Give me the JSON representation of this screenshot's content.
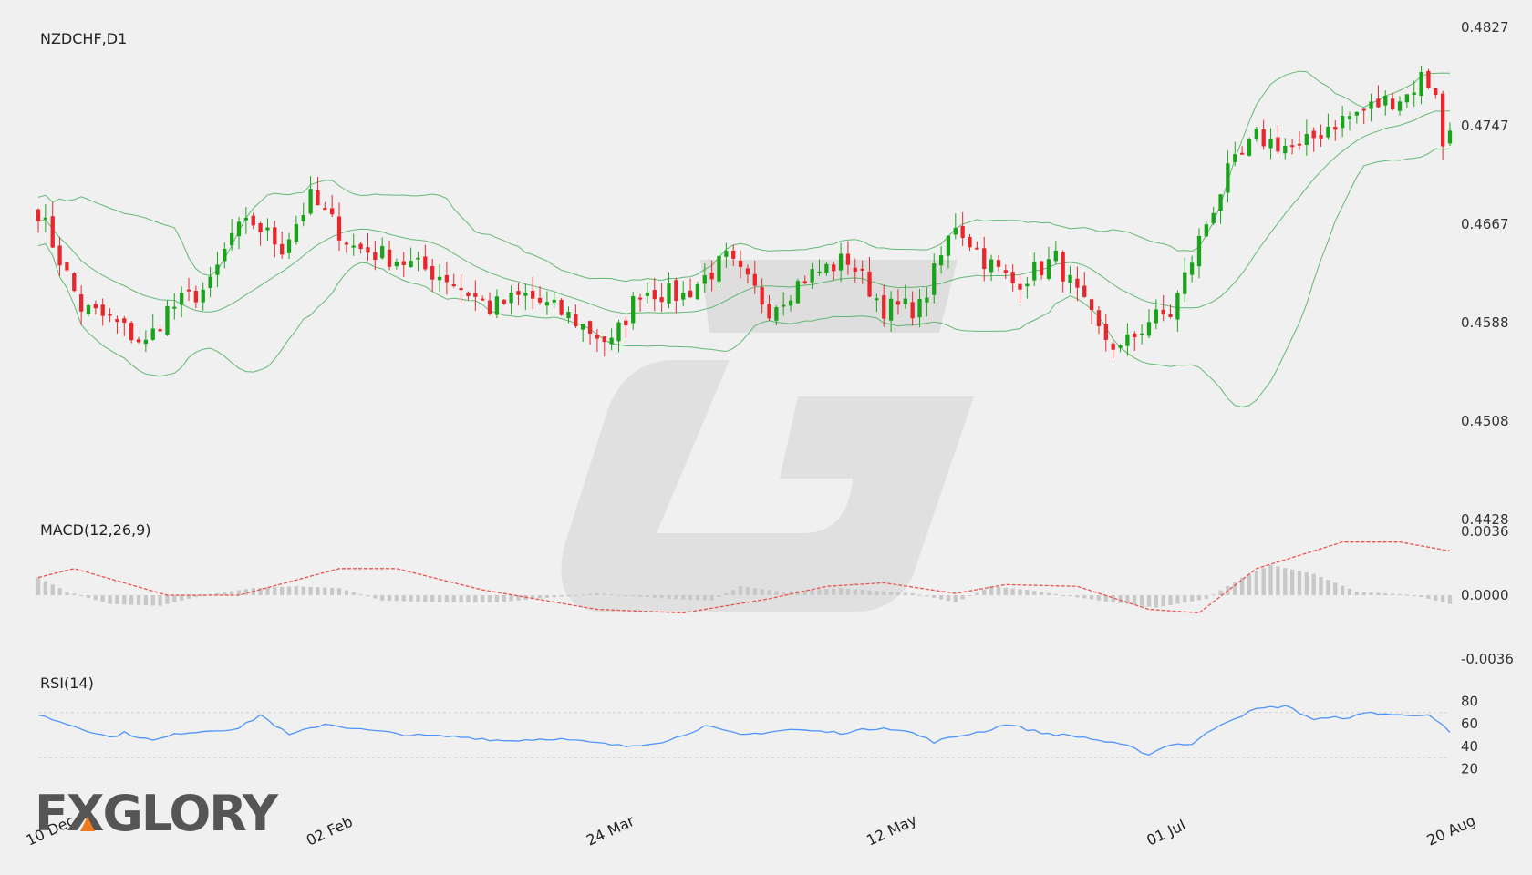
{
  "chart_data": {
    "type": "candlestick",
    "symbol_label": "NZDCHF,D1",
    "price_axis": {
      "ylim": [
        0.4428,
        0.4827
      ],
      "ticks": [
        "0.4827",
        "0.4747",
        "0.4667",
        "0.4588",
        "0.4508",
        "0.4428"
      ]
    },
    "date_ticks": [
      "10 Dec",
      "02 Feb",
      "24 Mar",
      "12 May",
      "01 Jul",
      "20 Aug"
    ],
    "close_anchors": [
      {
        "i": 0,
        "v": 0.468
      },
      {
        "i": 6,
        "v": 0.46
      },
      {
        "i": 10,
        "v": 0.459
      },
      {
        "i": 15,
        "v": 0.457
      },
      {
        "i": 18,
        "v": 0.4598
      },
      {
        "i": 24,
        "v": 0.4618
      },
      {
        "i": 27,
        "v": 0.466
      },
      {
        "i": 30,
        "v": 0.467
      },
      {
        "i": 34,
        "v": 0.465
      },
      {
        "i": 38,
        "v": 0.469
      },
      {
        "i": 44,
        "v": 0.465
      },
      {
        "i": 50,
        "v": 0.464
      },
      {
        "i": 57,
        "v": 0.4625
      },
      {
        "i": 63,
        "v": 0.46
      },
      {
        "i": 68,
        "v": 0.461
      },
      {
        "i": 74,
        "v": 0.4593
      },
      {
        "i": 80,
        "v": 0.457
      },
      {
        "i": 84,
        "v": 0.4615
      },
      {
        "i": 90,
        "v": 0.461
      },
      {
        "i": 96,
        "v": 0.464
      },
      {
        "i": 102,
        "v": 0.46
      },
      {
        "i": 107,
        "v": 0.4625
      },
      {
        "i": 113,
        "v": 0.464
      },
      {
        "i": 118,
        "v": 0.46
      },
      {
        "i": 123,
        "v": 0.46
      },
      {
        "i": 128,
        "v": 0.467
      },
      {
        "i": 132,
        "v": 0.464
      },
      {
        "i": 136,
        "v": 0.462
      },
      {
        "i": 142,
        "v": 0.464
      },
      {
        "i": 148,
        "v": 0.458
      },
      {
        "i": 151,
        "v": 0.4565
      },
      {
        "i": 155,
        "v": 0.459
      },
      {
        "i": 158,
        "v": 0.4595
      },
      {
        "i": 163,
        "v": 0.467
      },
      {
        "i": 166,
        "v": 0.471
      },
      {
        "i": 170,
        "v": 0.474
      },
      {
        "i": 176,
        "v": 0.473
      },
      {
        "i": 180,
        "v": 0.475
      },
      {
        "i": 184,
        "v": 0.476
      },
      {
        "i": 188,
        "v": 0.477
      },
      {
        "i": 191,
        "v": 0.4775
      },
      {
        "i": 193,
        "v": 0.479
      },
      {
        "i": 195,
        "v": 0.478
      },
      {
        "i": 196,
        "v": 0.473
      },
      {
        "i": 197,
        "v": 0.4747
      }
    ],
    "candle_count": 198,
    "bollinger_bands": true,
    "indicators": {
      "macd": {
        "label": "MACD(12,26,9)",
        "ylim": [
          -0.0036,
          0.0036
        ],
        "ticks": [
          "0.0036",
          "0.0000",
          "-0.0036"
        ],
        "signal_anchors": [
          {
            "i": 0,
            "v": 0.001
          },
          {
            "i": 5,
            "v": 0.0015
          },
          {
            "i": 18,
            "v": 0.0
          },
          {
            "i": 28,
            "v": 0.0
          },
          {
            "i": 42,
            "v": 0.0015
          },
          {
            "i": 50,
            "v": 0.0015
          },
          {
            "i": 62,
            "v": 0.0003
          },
          {
            "i": 78,
            "v": -0.0008
          },
          {
            "i": 90,
            "v": -0.001
          },
          {
            "i": 102,
            "v": -0.0002
          },
          {
            "i": 110,
            "v": 0.0005
          },
          {
            "i": 118,
            "v": 0.0007
          },
          {
            "i": 128,
            "v": 0.0001
          },
          {
            "i": 135,
            "v": 0.0006
          },
          {
            "i": 145,
            "v": 0.0005
          },
          {
            "i": 155,
            "v": -0.0008
          },
          {
            "i": 162,
            "v": -0.001
          },
          {
            "i": 170,
            "v": 0.0015
          },
          {
            "i": 182,
            "v": 0.003
          },
          {
            "i": 190,
            "v": 0.003
          },
          {
            "i": 197,
            "v": 0.0025
          }
        ],
        "hist_anchors": [
          {
            "i": 0,
            "v": 0.001
          },
          {
            "i": 4,
            "v": 0.0002
          },
          {
            "i": 10,
            "v": -0.0005
          },
          {
            "i": 17,
            "v": -0.0006
          },
          {
            "i": 23,
            "v": 0.0
          },
          {
            "i": 30,
            "v": 0.0004
          },
          {
            "i": 36,
            "v": 0.0005
          },
          {
            "i": 42,
            "v": 0.0004
          },
          {
            "i": 48,
            "v": -0.0003
          },
          {
            "i": 56,
            "v": -0.0004
          },
          {
            "i": 64,
            "v": -0.0004
          },
          {
            "i": 78,
            "v": 0.0001
          },
          {
            "i": 88,
            "v": -0.0002
          },
          {
            "i": 94,
            "v": -0.0003
          },
          {
            "i": 98,
            "v": 0.0005
          },
          {
            "i": 104,
            "v": 0.0002
          },
          {
            "i": 112,
            "v": 0.0004
          },
          {
            "i": 122,
            "v": 0.0001
          },
          {
            "i": 128,
            "v": -0.0004
          },
          {
            "i": 133,
            "v": 0.0005
          },
          {
            "i": 138,
            "v": 0.0003
          },
          {
            "i": 148,
            "v": -0.0003
          },
          {
            "i": 156,
            "v": -0.0007
          },
          {
            "i": 163,
            "v": -0.0002
          },
          {
            "i": 168,
            "v": 0.001
          },
          {
            "i": 172,
            "v": 0.0017
          },
          {
            "i": 178,
            "v": 0.0012
          },
          {
            "i": 184,
            "v": 0.0002
          },
          {
            "i": 192,
            "v": 0.0
          },
          {
            "i": 197,
            "v": -0.0005
          }
        ]
      },
      "rsi": {
        "label": "RSI(14)",
        "ylim": [
          10,
          90
        ],
        "ticks": [
          "80",
          "60",
          "40",
          "20"
        ],
        "levels": [
          70,
          30
        ],
        "anchors": [
          {
            "i": 0,
            "v": 68
          },
          {
            "i": 3,
            "v": 62
          },
          {
            "i": 10,
            "v": 48
          },
          {
            "i": 12,
            "v": 52
          },
          {
            "i": 16,
            "v": 45
          },
          {
            "i": 20,
            "v": 52
          },
          {
            "i": 28,
            "v": 56
          },
          {
            "i": 31,
            "v": 68
          },
          {
            "i": 35,
            "v": 50
          },
          {
            "i": 40,
            "v": 60
          },
          {
            "i": 45,
            "v": 55
          },
          {
            "i": 52,
            "v": 50
          },
          {
            "i": 60,
            "v": 48
          },
          {
            "i": 65,
            "v": 45
          },
          {
            "i": 72,
            "v": 47
          },
          {
            "i": 82,
            "v": 40
          },
          {
            "i": 88,
            "v": 45
          },
          {
            "i": 93,
            "v": 58
          },
          {
            "i": 98,
            "v": 50
          },
          {
            "i": 105,
            "v": 55
          },
          {
            "i": 112,
            "v": 52
          },
          {
            "i": 118,
            "v": 57
          },
          {
            "i": 122,
            "v": 52
          },
          {
            "i": 125,
            "v": 44
          },
          {
            "i": 129,
            "v": 50
          },
          {
            "i": 133,
            "v": 55
          },
          {
            "i": 135,
            "v": 60
          },
          {
            "i": 140,
            "v": 52
          },
          {
            "i": 146,
            "v": 48
          },
          {
            "i": 152,
            "v": 40
          },
          {
            "i": 155,
            "v": 33
          },
          {
            "i": 158,
            "v": 42
          },
          {
            "i": 161,
            "v": 42
          },
          {
            "i": 165,
            "v": 60
          },
          {
            "i": 170,
            "v": 73
          },
          {
            "i": 174,
            "v": 76
          },
          {
            "i": 178,
            "v": 64
          },
          {
            "i": 183,
            "v": 66
          },
          {
            "i": 186,
            "v": 70
          },
          {
            "i": 191,
            "v": 67
          },
          {
            "i": 194,
            "v": 69
          },
          {
            "i": 196,
            "v": 58
          },
          {
            "i": 197,
            "v": 52
          }
        ]
      }
    },
    "colors": {
      "up": "#1aa31a",
      "down": "#e8262b",
      "band": "#4aaf5e",
      "signal": "#e8544f",
      "hist": "#c8c8c8",
      "rsi": "#4d94ff",
      "background": "#f0f0f0"
    }
  },
  "brand": {
    "logo_text": "FXGLORY"
  }
}
